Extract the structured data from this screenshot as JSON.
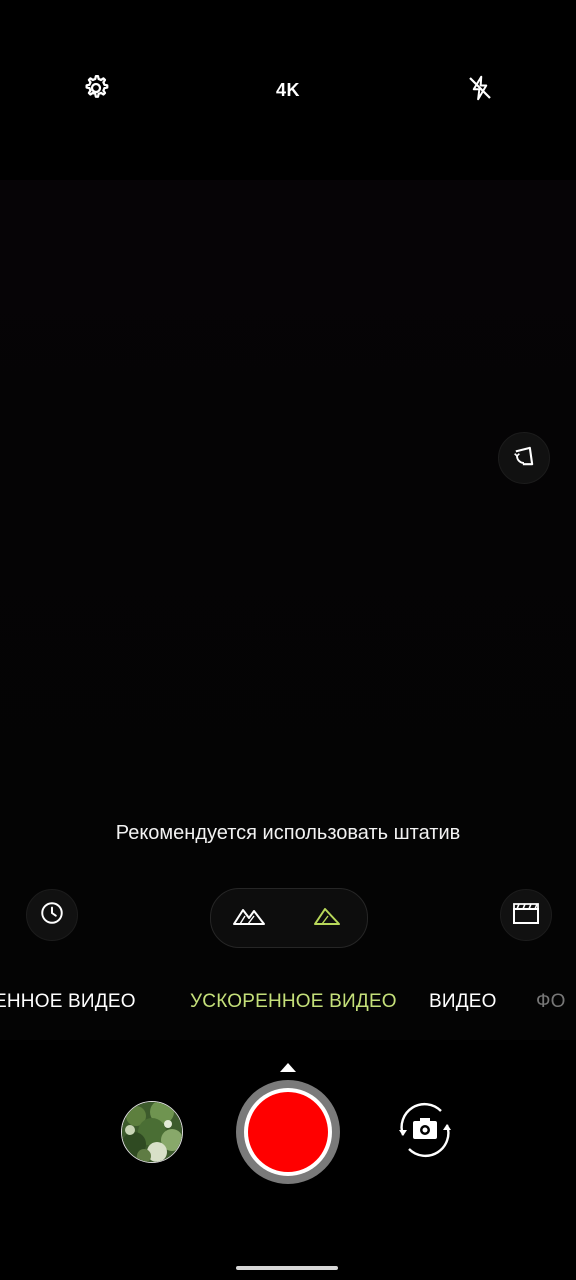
{
  "top_bar": {
    "settings_icon": "gear-icon",
    "resolution_label": "4K",
    "flash_icon": "flash-off-icon"
  },
  "side_controls": {
    "leveler_icon": "level-rotate-icon",
    "timer_icon": "clock-icon",
    "clapper_icon": "clapperboard-icon"
  },
  "hint": "Рекомендуется использовать штатив",
  "scene_toggle": {
    "options": [
      "mountains-icon",
      "mountain-outline-icon"
    ],
    "selected_index": 1,
    "accent": "#b8d85a"
  },
  "modes": {
    "items": [
      "ЕННОЕ ВИДЕО",
      "УСКОРЕННОЕ ВИДЕО",
      "ВИДЕО",
      "ФО"
    ],
    "active_index": 1,
    "active_color": "#c5e07a"
  },
  "bottom": {
    "gallery_icon": "gallery-thumbnail",
    "shutter_icon": "record-button",
    "switch_icon": "switch-camera-icon",
    "record_color": "#ff0000"
  }
}
